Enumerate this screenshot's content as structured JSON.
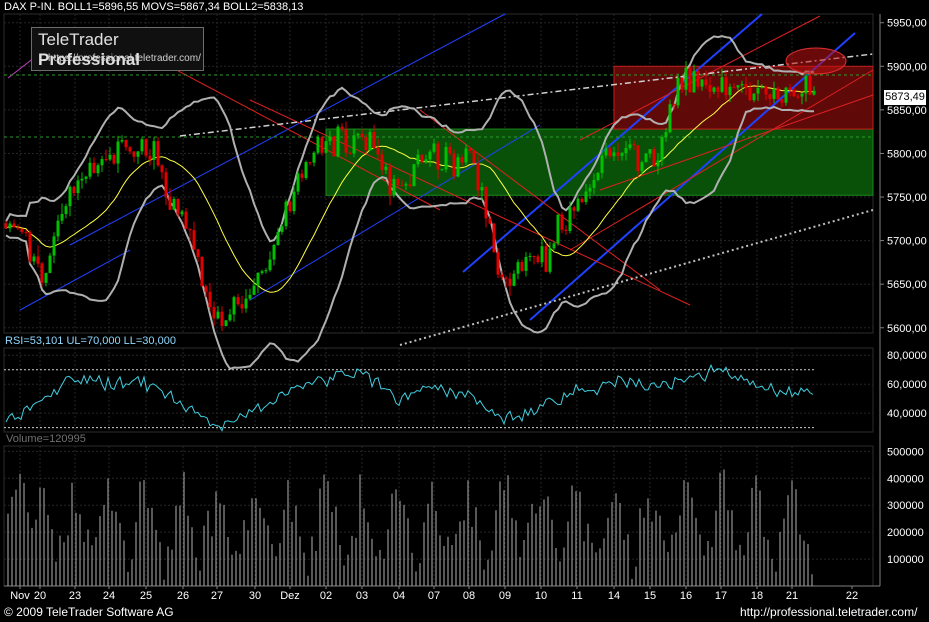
{
  "header": {
    "instrument": "DAX P-IN.",
    "boll1": "BOLL1=5896,55",
    "movs": "MOVS=5867,34",
    "boll2": "BOLL2=5838,13"
  },
  "logo": {
    "title_normal": "TeleTrader ",
    "title_bold": "Professional",
    "url": "https://professional.teletrader.com/"
  },
  "rsi_header": "RSI=53,101 UL=70,000 LL=30,000",
  "volume_header": "Volume=120995",
  "footer": {
    "copyright": "© 2009 TeleTrader Software AG",
    "url": "http://professional.teletrader.com/"
  },
  "last_price_label": "5873,49",
  "colors": {
    "background": "#000000",
    "up_candle": "#00c000",
    "down_candle": "#e00000",
    "bollinger": "#b0b0b0",
    "moving_average": "#ffff40",
    "rsi_line": "#40d0e0",
    "volume": "#b0b0b0",
    "green_zone": "#0a5a0a",
    "red_zone": "#6a0a0a",
    "trend_blue": "#2040ff",
    "trend_red": "#e02020"
  },
  "chart_data": [
    {
      "type": "candlestick",
      "title": "",
      "x_tick_labels": [
        "Nov",
        "20",
        "23",
        "24",
        "25",
        "26",
        "27",
        "30",
        "Dez",
        "02",
        "03",
        "04",
        "07",
        "08",
        "09",
        "10",
        "11",
        "14",
        "15",
        "16",
        "17",
        "18",
        "21",
        "22"
      ],
      "y_tick_labels": [
        "5950,00",
        "5900,00",
        "5850,00",
        "5800,00",
        "5750,00",
        "5700,00",
        "5650,00",
        "5600,00"
      ],
      "ylim": [
        5594,
        5960
      ],
      "grid": true,
      "last_price": 5873.49,
      "session_anchors": [
        {
          "label": "Nov",
          "close": 5720
        },
        {
          "label": "20",
          "close": 5665
        },
        {
          "label": "23",
          "close": 5765
        },
        {
          "label": "24",
          "close": 5800
        },
        {
          "label": "25",
          "close": 5805
        },
        {
          "label": "26",
          "close": 5730
        },
        {
          "label": "27",
          "close": 5610
        },
        {
          "label": "30",
          "close": 5645
        },
        {
          "label": "Dez",
          "close": 5750
        },
        {
          "label": "02",
          "close": 5815
        },
        {
          "label": "03",
          "close": 5810
        },
        {
          "label": "04",
          "close": 5755
        },
        {
          "label": "07",
          "close": 5800
        },
        {
          "label": "08",
          "close": 5790
        },
        {
          "label": "09",
          "close": 5665
        },
        {
          "label": "10",
          "close": 5680
        },
        {
          "label": "11",
          "close": 5745
        },
        {
          "label": "14",
          "close": 5810
        },
        {
          "label": "15",
          "close": 5795
        },
        {
          "label": "16",
          "close": 5880
        },
        {
          "label": "17",
          "close": 5875
        },
        {
          "label": "18",
          "close": 5870
        },
        {
          "label": "21",
          "close": 5873
        }
      ],
      "zones": [
        {
          "name": "green-zone",
          "from_session": "02",
          "y": [
            5752,
            5828
          ]
        },
        {
          "name": "red-zone",
          "from_session": "14",
          "y": [
            5828,
            5900
          ]
        }
      ]
    },
    {
      "type": "line",
      "title": "RSI",
      "y_tick_labels": [
        "80,0000",
        "60,0000",
        "40,0000"
      ],
      "ylim": [
        27,
        85
      ],
      "upper_limit": 70,
      "lower_limit": 30,
      "session_anchors": [
        37,
        48,
        65,
        60,
        62,
        45,
        30,
        42,
        55,
        65,
        68,
        50,
        58,
        52,
        35,
        45,
        55,
        62,
        58,
        65,
        70,
        58,
        53
      ]
    },
    {
      "type": "bar",
      "title": "Volume",
      "y_tick_labels": [
        "500000",
        "400000",
        "300000",
        "200000",
        "100000"
      ],
      "ylim": [
        0,
        520000
      ],
      "last_value": 120995
    }
  ]
}
